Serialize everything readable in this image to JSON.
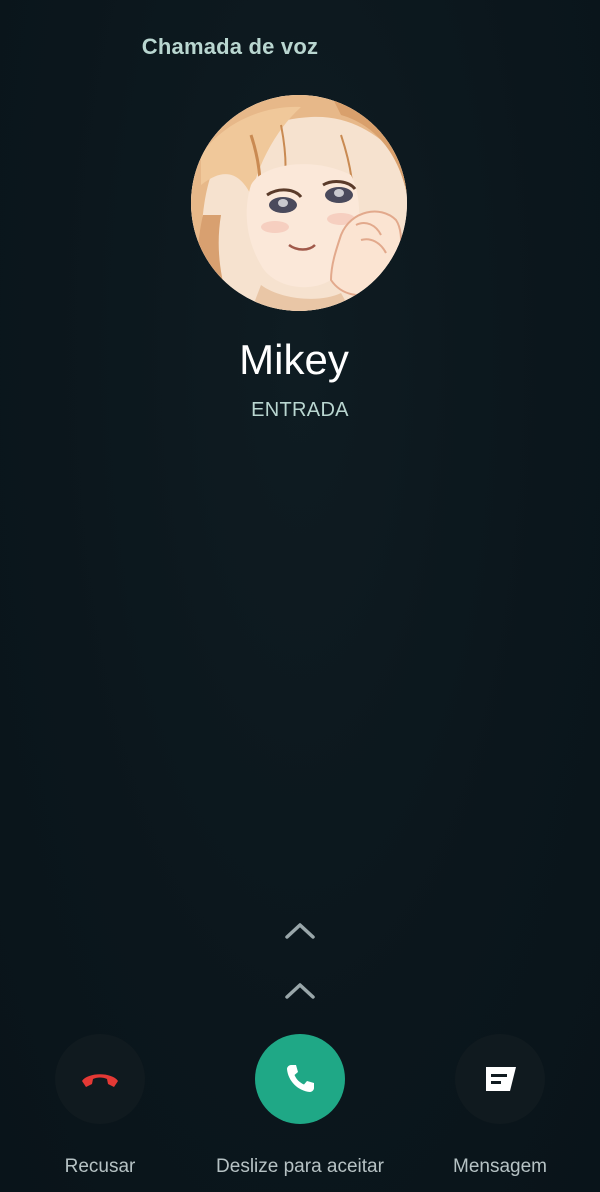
{
  "header": {
    "title": "Chamada de voz"
  },
  "caller": {
    "name": "Mikey",
    "status": "ENTRADA",
    "avatar_icon": "contact-photo"
  },
  "swipe_hint": {
    "icon": "chevron-up-icon"
  },
  "actions": {
    "decline": {
      "label": "Recusar",
      "icon": "hang-up-icon",
      "color": "#e53935"
    },
    "accept": {
      "label": "Deslize para aceitar",
      "icon": "phone-icon",
      "color": "#1fa886"
    },
    "message": {
      "label": "Mensagem",
      "icon": "message-icon",
      "color": "#ffffff"
    }
  },
  "colors": {
    "background": "#0b161c",
    "accent_text": "#b9d6d0",
    "accept_green": "#1fa886",
    "decline_red": "#e53935"
  }
}
